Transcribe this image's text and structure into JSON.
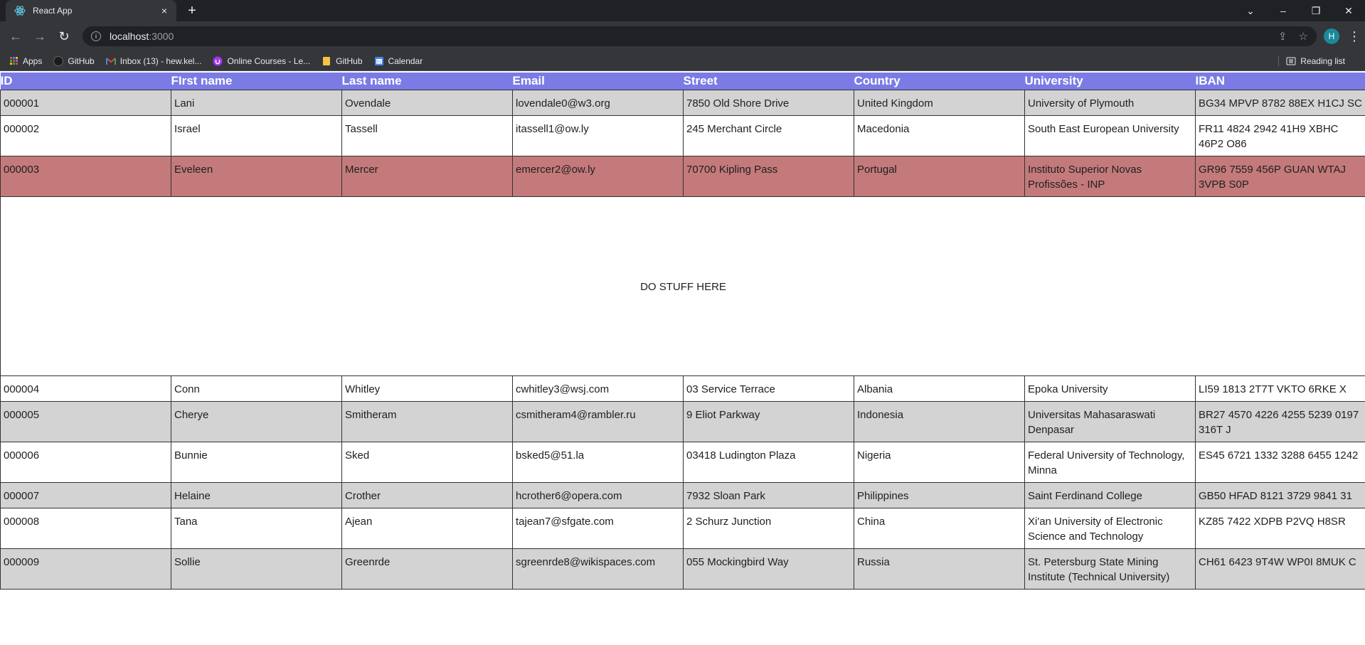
{
  "browser": {
    "tab_title": "React App",
    "tab_close": "×",
    "new_tab": "+",
    "url_host": "localhost",
    "url_port": ":3000",
    "window_controls": [
      "⌄",
      "–",
      "❐",
      "✕"
    ],
    "bookmarks": [
      {
        "label": "Apps",
        "icon": "apps-grid-icon"
      },
      {
        "label": "GitHub",
        "icon": "github-icon"
      },
      {
        "label": "Inbox (13) - hew.kel...",
        "icon": "gmail-icon"
      },
      {
        "label": "Online Courses - Le...",
        "icon": "udemy-icon"
      },
      {
        "label": "GitHub",
        "icon": "folder-icon"
      },
      {
        "label": "Calendar",
        "icon": "calendar-icon"
      }
    ],
    "reading_list": "Reading list",
    "profile_initial": "H"
  },
  "table": {
    "headers": [
      "ID",
      "FIrst name",
      "Last name",
      "Email",
      "Street",
      "Country",
      "University",
      "IBAN"
    ],
    "rows_top": [
      {
        "id": "000001",
        "first": "Lani",
        "last": "Ovendale",
        "email": "lovendale0@w3.org",
        "street": "7850 Old Shore Drive",
        "country": "United Kingdom",
        "university": "University of Plymouth",
        "iban": "BG34 MPVP 8782 88EX H1CJ SC",
        "style": "gray"
      },
      {
        "id": "000002",
        "first": "Israel",
        "last": "Tassell",
        "email": "itassell1@ow.ly",
        "street": "245 Merchant Circle",
        "country": "Macedonia",
        "university": "South East European University",
        "iban": "FR11 4824 2942 41H9 XBHC 46P2 O86",
        "style": "white"
      },
      {
        "id": "000003",
        "first": "Eveleen",
        "last": "Mercer",
        "email": "emercer2@ow.ly",
        "street": "70700 Kipling Pass",
        "country": "Portugal",
        "university": "Instituto Superior Novas Profissões - INP",
        "iban": "GR96 7559 456P GUAN WTAJ 3VPB S0P",
        "style": "selected"
      }
    ],
    "detail_text": "DO STUFF HERE",
    "rows_bottom": [
      {
        "id": "000004",
        "first": "Conn",
        "last": "Whitley",
        "email": "cwhitley3@wsj.com",
        "street": "03 Service Terrace",
        "country": "Albania",
        "university": "Epoka University",
        "iban": "LI59 1813 2T7T VKTO 6RKE X",
        "style": "white"
      },
      {
        "id": "000005",
        "first": "Cherye",
        "last": "Smitheram",
        "email": "csmitheram4@rambler.ru",
        "street": "9 Eliot Parkway",
        "country": "Indonesia",
        "university": "Universitas Mahasaraswati Denpasar",
        "iban": "BR27 4570 4226 4255 5239 0197 316T J",
        "style": "gray"
      },
      {
        "id": "000006",
        "first": "Bunnie",
        "last": "Sked",
        "email": "bsked5@51.la",
        "street": "03418 Ludington Plaza",
        "country": "Nigeria",
        "university": "Federal University of Technology, Minna",
        "iban": "ES45 6721 1332 3288 6455 1242",
        "style": "white"
      },
      {
        "id": "000007",
        "first": "Helaine",
        "last": "Crother",
        "email": "hcrother6@opera.com",
        "street": "7932 Sloan Park",
        "country": "Philippines",
        "university": "Saint Ferdinand College",
        "iban": "GB50 HFAD 8121 3729 9841 31",
        "style": "gray"
      },
      {
        "id": "000008",
        "first": "Tana",
        "last": "Ajean",
        "email": "tajean7@sfgate.com",
        "street": "2 Schurz Junction",
        "country": "China",
        "university": "Xi'an University of Electronic Science and Technology",
        "iban": "KZ85 7422 XDPB P2VQ H8SR",
        "style": "white"
      },
      {
        "id": "000009",
        "first": "Sollie",
        "last": "Greenrde",
        "email": "sgreenrde8@wikispaces.com",
        "street": "055 Mockingbird Way",
        "country": "Russia",
        "university": "St. Petersburg State Mining Institute (Technical University)",
        "iban": "CH61 6423 9T4W WP0I 8MUK C",
        "style": "gray"
      }
    ]
  },
  "colors": {
    "header_bg": "#7b7be6",
    "selected_row": "#c47a7a",
    "gray_row": "#d3d3d3",
    "chrome_dark": "#202124",
    "chrome_toolbar": "#35363a"
  }
}
